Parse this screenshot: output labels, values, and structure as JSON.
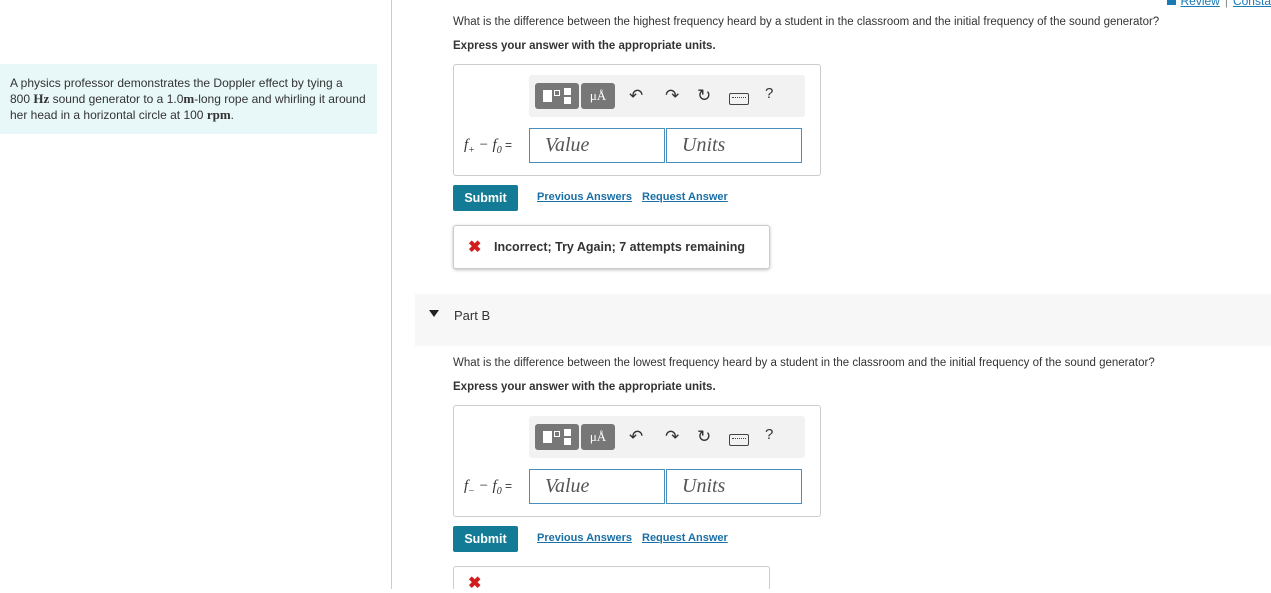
{
  "top_nav": {
    "review": "Review",
    "constants": "Consta"
  },
  "intro": {
    "part1": "A physics professor demonstrates the Doppler effect by tying a",
    "value_800": "800",
    "unit_hz": "Hz",
    "part2": " sound generator to a ",
    "value_len": "1.0",
    "unit_m": "m",
    "part3": "-long rope and whirling it around her head in a horizontal circle at ",
    "value_rpm": "100",
    "unit_rpm": "rpm",
    "part4": "."
  },
  "toolbar": {
    "mu_label": "μÅ",
    "undo": "↶",
    "redo": "↷",
    "reset": "↻",
    "help": "?"
  },
  "partA": {
    "question": "What is the difference between the highest frequency heard by a student in the classroom and the initial frequency of the sound generator?",
    "instruction": "Express your answer with the appropriate units.",
    "eq_f": "f",
    "eq_sub": "+",
    "eq_mid": " − f",
    "eq_sub0": "0",
    "eq_equals": " =",
    "value_placeholder": "Value",
    "units_placeholder": "Units",
    "submit": "Submit",
    "previous_answers": "Previous Answers",
    "request_answer": "Request Answer",
    "feedback_icon": "✖",
    "feedback": "Incorrect; Try Again; 7 attempts remaining"
  },
  "partB": {
    "title": "Part B",
    "question": "What is the difference between the lowest frequency heard by a student in the classroom and the initial frequency of the sound generator?",
    "instruction": "Express your answer with the appropriate units.",
    "eq_f": "f",
    "eq_sub": "−",
    "eq_mid": " − f",
    "eq_sub0": "0",
    "eq_equals": " =",
    "value_placeholder": "Value",
    "units_placeholder": "Units",
    "submit": "Submit",
    "previous_answers": "Previous Answers",
    "request_answer": "Request Answer"
  }
}
